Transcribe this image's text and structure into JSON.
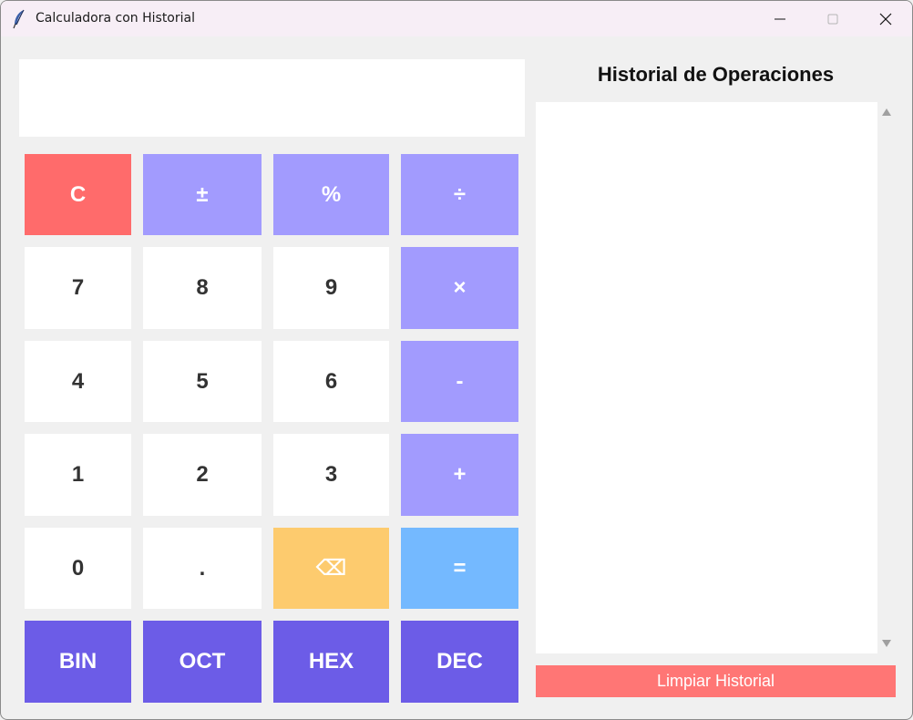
{
  "window": {
    "title": "Calculadora con Historial",
    "icon": "feather-icon"
  },
  "display": {
    "value": ""
  },
  "keys": {
    "clear": "C",
    "plus_minus": "±",
    "percent": "%",
    "divide": "÷",
    "seven": "7",
    "eight": "8",
    "nine": "9",
    "multiply": "×",
    "four": "4",
    "five": "5",
    "six": "6",
    "minus": "-",
    "one": "1",
    "two": "2",
    "three": "3",
    "plus": "+",
    "zero": "0",
    "decimal": ".",
    "backspace": "⌫",
    "equals": "=",
    "bin": "BIN",
    "oct": "OCT",
    "hex": "HEX",
    "dec": "DEC"
  },
  "history": {
    "title": "Historial de Operaciones",
    "entries": [],
    "clear_label": "Limpiar Historial"
  },
  "colors": {
    "clear": "#ff6b6b",
    "operator": "#a29bfe",
    "number": "#ffffff",
    "backspace": "#fdcb6e",
    "equals": "#74b9ff",
    "base": "#6c5ce7",
    "clear_history": "#ff7675"
  }
}
